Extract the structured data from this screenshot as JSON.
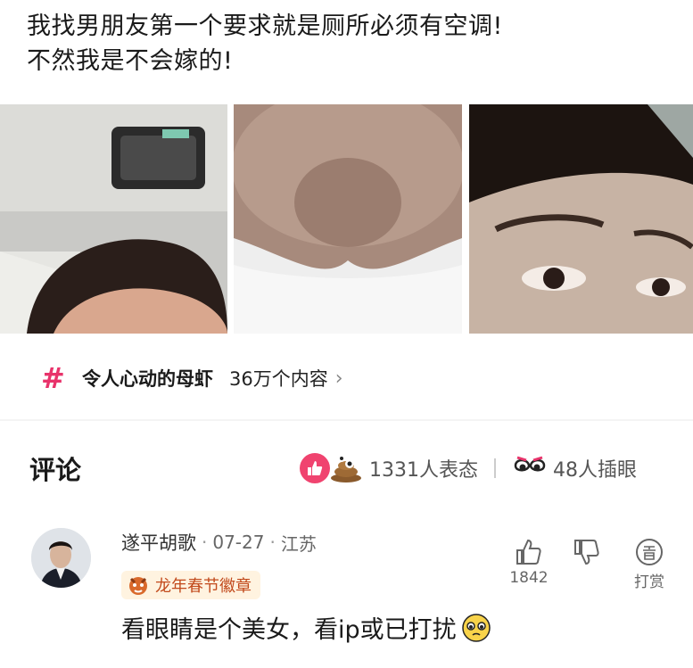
{
  "post": {
    "line1": "我找男朋友第一个要求就是厕所必须有空调!",
    "line2": "不然我是不会嫁的!"
  },
  "topic": {
    "hash": "#",
    "name": "令人心动的母虾",
    "count": "36万个内容",
    "chevron": "›"
  },
  "comments_section": {
    "title": "评论",
    "reactions_count": "1331人表态",
    "eye_count": "48人插眼"
  },
  "comment": {
    "username": "遂平胡歌",
    "date": "07-27",
    "location": "江苏",
    "dot": "·",
    "badge": "龙年春节徽章",
    "text": "看眼睛是个美女，看ip或已打扰",
    "like_count": "1842",
    "tip_label": "打赏"
  },
  "colors": {
    "accent_pink": "#e8336b",
    "badge_text": "#c24a1c",
    "badge_bg": "#fff3e0"
  }
}
